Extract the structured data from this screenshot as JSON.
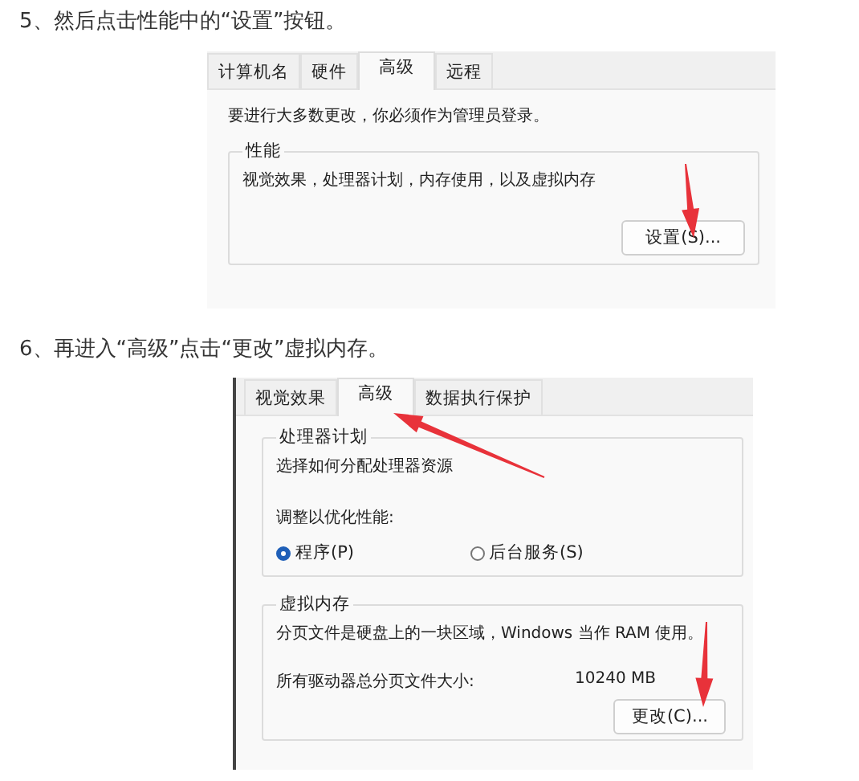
{
  "step5": {
    "caption": "5、然后点击性能中的“设置”按钮。",
    "tabs": [
      {
        "label": "计算机名",
        "selected": false
      },
      {
        "label": "硬件",
        "selected": false
      },
      {
        "label": "高级",
        "selected": true
      },
      {
        "label": "远程",
        "selected": false
      }
    ],
    "notice": "要进行大多数更改，你必须作为管理员登录。",
    "group": {
      "title": "性能",
      "description": "视觉效果，处理器计划，内存使用，以及虚拟内存",
      "button": "设置(S)..."
    }
  },
  "step6": {
    "caption": "6、再进入“高级”点击“更改”虚拟内存。",
    "tabs": [
      {
        "label": "视觉效果",
        "selected": false
      },
      {
        "label": "高级",
        "selected": true
      },
      {
        "label": "数据执行保护",
        "selected": false
      }
    ],
    "processor_group": {
      "title": "处理器计划",
      "description": "选择如何分配处理器资源",
      "adjust_label": "调整以优化性能:",
      "options": [
        {
          "label": "程序(P)",
          "selected": true
        },
        {
          "label": "后台服务(S)",
          "selected": false
        }
      ]
    },
    "memory_group": {
      "title": "虚拟内存",
      "description": "分页文件是硬盘上的一块区域，Windows 当作 RAM 使用。",
      "total_label": "所有驱动器总分页文件大小:",
      "total_value": "10240 MB",
      "button": "更改(C)..."
    }
  }
}
